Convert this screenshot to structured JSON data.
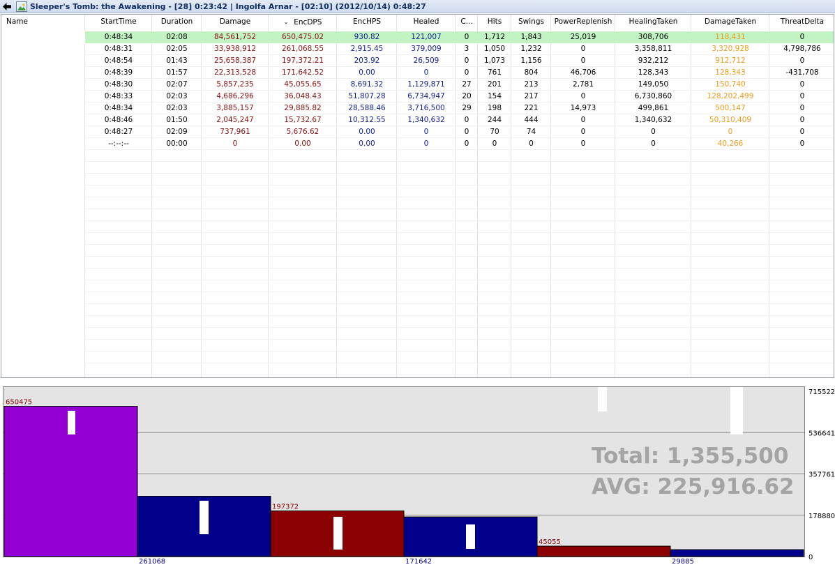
{
  "window": {
    "title": "Sleeper's Tomb: the Awakening - [28] 0:23:42  |  Ingolfa Arnar - [02:10] (2012/10/14) 0:48:27",
    "back_icon": "back-arrow-icon",
    "image_icon": "picture-icon"
  },
  "table": {
    "columns": [
      "Name",
      "StartTime",
      "Duration",
      "Damage",
      "EncDPS",
      "EncHPS",
      "Healed",
      "C...",
      "Hits",
      "Swings",
      "PowerReplenish",
      "HealingTaken",
      "DamageTaken",
      "ThreatDelta"
    ],
    "sorted_column": "EncDPS",
    "sort_indicator": "⌄",
    "selected_row": 0,
    "rows": [
      [
        "",
        "0:48:34",
        "02:08",
        "84,561,752",
        "650,475.02",
        "930.82",
        "121,007",
        "0",
        "1,712",
        "1,843",
        "25,019",
        "308,706",
        "118,431",
        "0"
      ],
      [
        "",
        "0:48:31",
        "02:05",
        "33,938,912",
        "261,068.55",
        "2,915.45",
        "379,009",
        "3",
        "1,050",
        "1,232",
        "0",
        "3,358,811",
        "3,320,928",
        "4,798,786"
      ],
      [
        "",
        "0:48:54",
        "01:43",
        "25,658,387",
        "197,372.21",
        "203.92",
        "26,509",
        "0",
        "1,073",
        "1,156",
        "0",
        "932,212",
        "912,712",
        "0"
      ],
      [
        "",
        "0:48:39",
        "01:57",
        "22,313,528",
        "171,642.52",
        "0.00",
        "0",
        "0",
        "761",
        "804",
        "46,706",
        "128,343",
        "128,343",
        "-431,708"
      ],
      [
        "",
        "0:48:30",
        "02:07",
        "5,857,235",
        "45,055.65",
        "8,691.32",
        "1,129,871",
        "27",
        "201",
        "213",
        "2,781",
        "149,050",
        "150,740",
        "0"
      ],
      [
        "",
        "0:48:33",
        "02:03",
        "4,686,296",
        "36,048.43",
        "51,807.28",
        "6,734,947",
        "20",
        "154",
        "217",
        "0",
        "6,730,860",
        "128,202,499",
        "0"
      ],
      [
        "",
        "0:48:34",
        "02:03",
        "3,885,157",
        "29,885.82",
        "28,588.46",
        "3,716,500",
        "29",
        "198",
        "221",
        "14,973",
        "499,861",
        "500,147",
        "0"
      ],
      [
        "",
        "0:48:46",
        "01:50",
        "2,045,247",
        "15,732.67",
        "10,312.55",
        "1,340,632",
        "0",
        "244",
        "444",
        "0",
        "1,340,632",
        "50,310,409",
        "0"
      ],
      [
        "",
        "0:48:27",
        "02:09",
        "737,961",
        "5,676.62",
        "0.00",
        "0",
        "0",
        "70",
        "74",
        "0",
        "0",
        "0",
        "0"
      ],
      [
        "",
        "--:--:--",
        "00:00",
        "0",
        "0.00",
        "0.00",
        "0",
        "0",
        "0",
        "0",
        "0",
        "0",
        "40,266",
        "0"
      ]
    ]
  },
  "graph": {
    "y_ticks": [
      "715522",
      "536641",
      "357761",
      "178880",
      "0"
    ],
    "total_text": "Total: 1,355,500",
    "avg_text": "AVG: 225,916.62",
    "colors": {
      "purple": "#9400d3",
      "blue": "#00008b",
      "red": "#8b0000"
    },
    "chart_data": {
      "type": "bar",
      "ylim": [
        0,
        715522
      ],
      "values": [
        650475,
        261068,
        197372,
        171642,
        45055,
        29885
      ],
      "labels": [
        "650475",
        "261068",
        "197372",
        "171642",
        "45055",
        "29885"
      ],
      "label_position": [
        "top",
        "bottom",
        "top",
        "bottom",
        "top",
        "bottom"
      ],
      "colors": [
        "purple",
        "blue",
        "red",
        "blue",
        "red",
        "blue"
      ]
    }
  }
}
